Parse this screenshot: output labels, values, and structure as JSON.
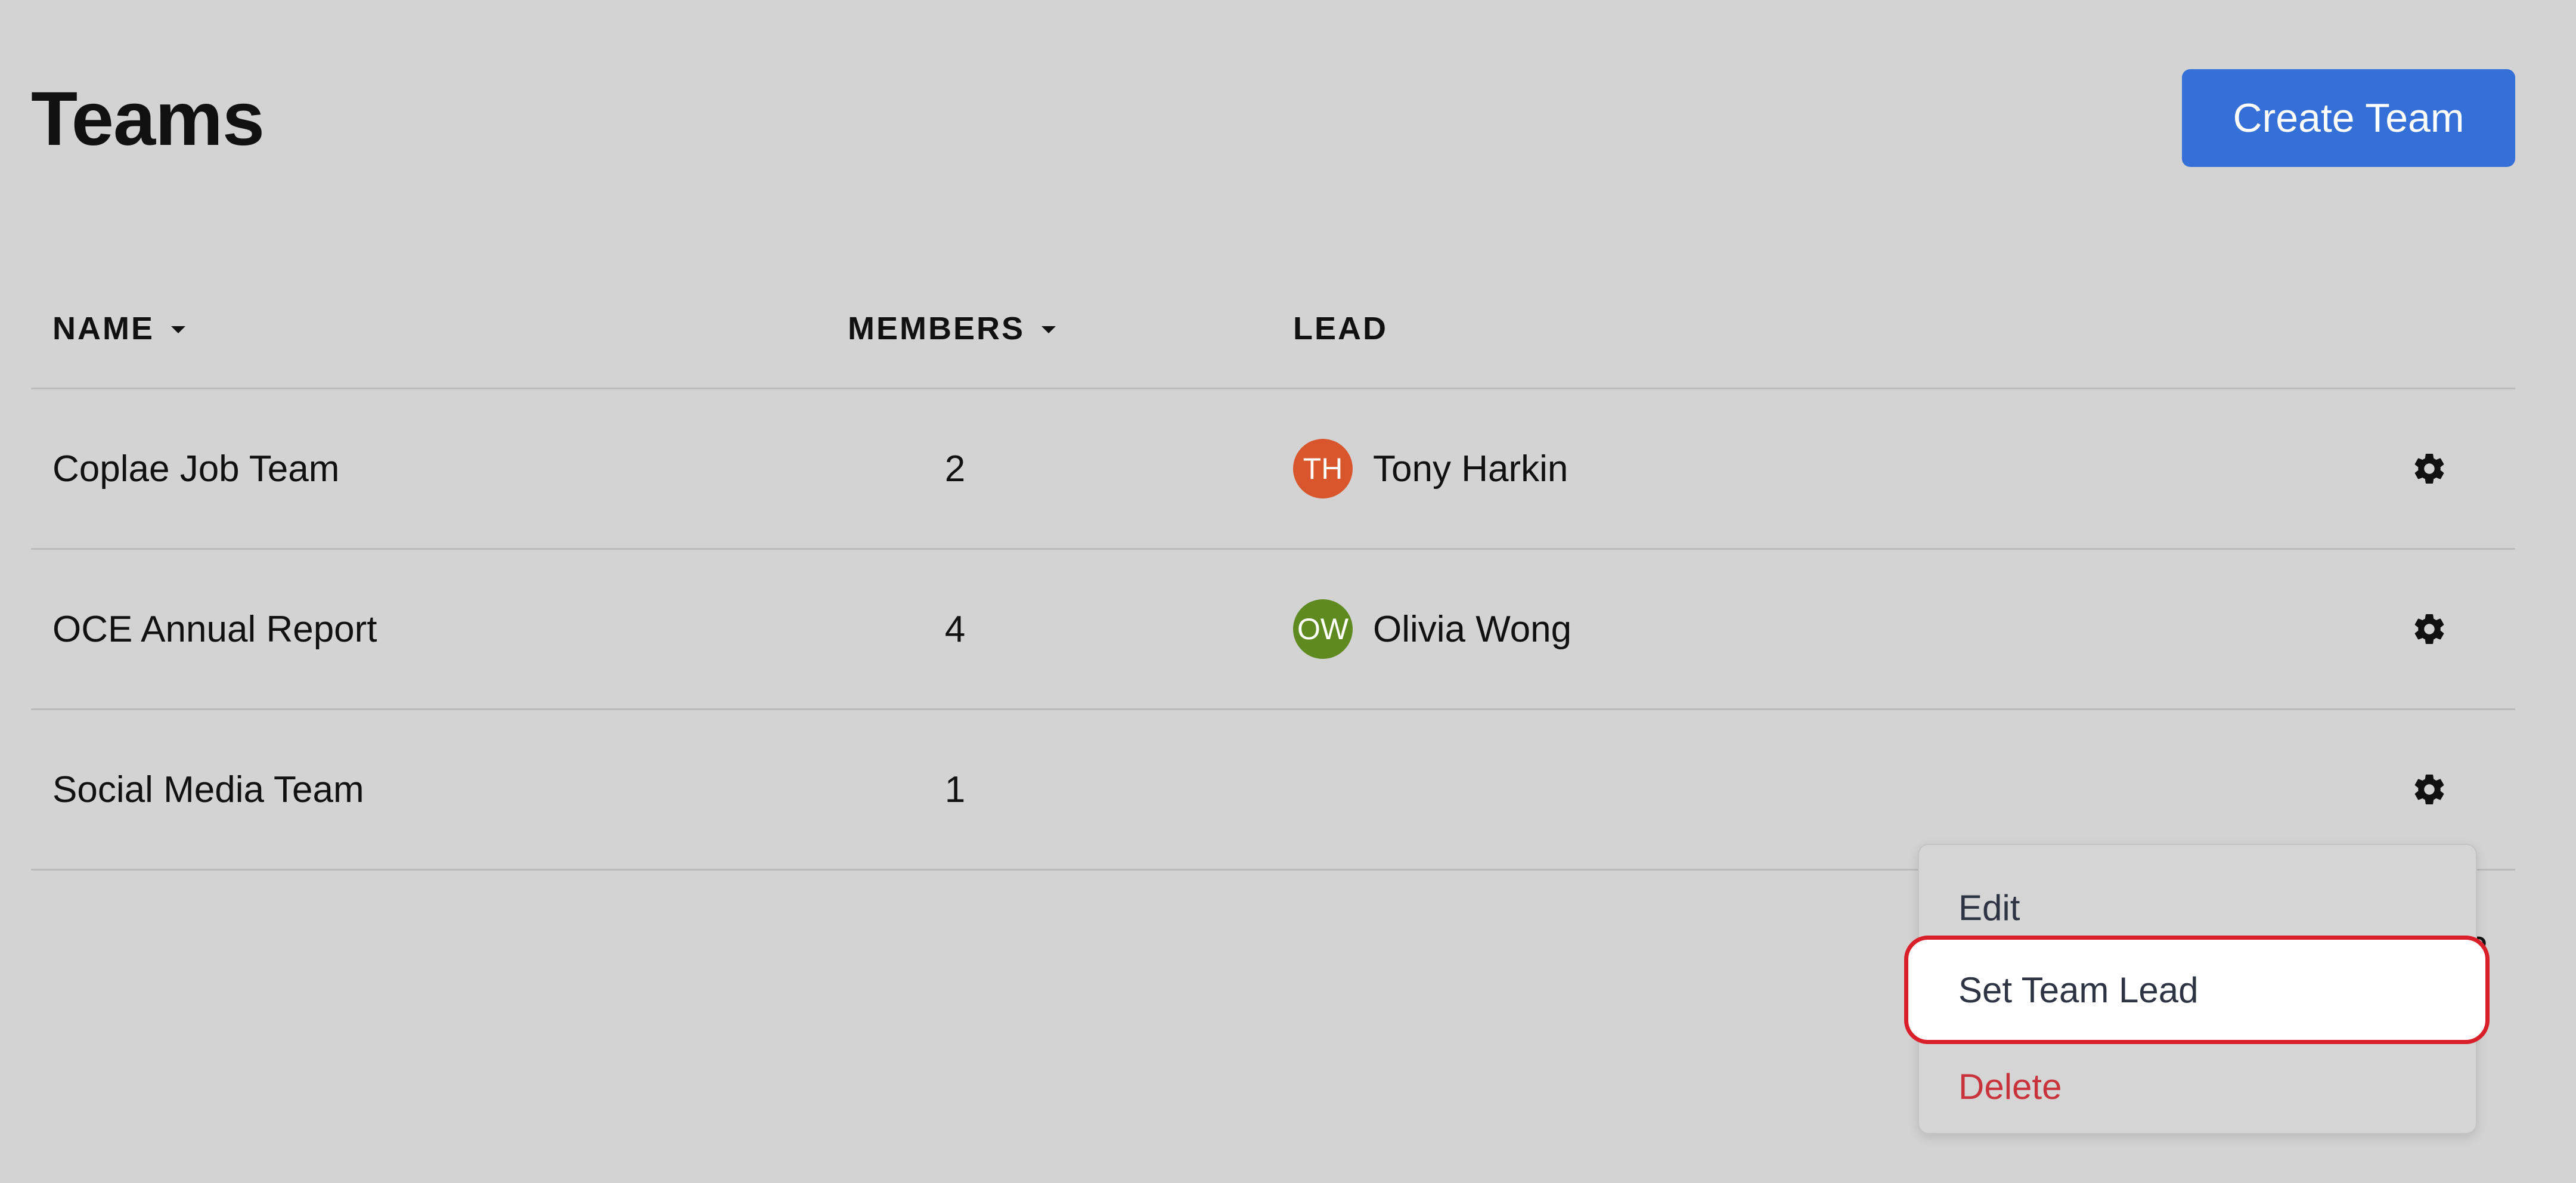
{
  "page": {
    "title": "Teams",
    "create_button_label": "Create Team",
    "pagination_text": "3"
  },
  "table": {
    "columns": {
      "name": "NAME",
      "members": "MEMBERS",
      "lead": "LEAD"
    },
    "rows": [
      {
        "name": "Coplae Job Team",
        "members": "2",
        "lead": {
          "initials": "TH",
          "name": "Tony Harkin",
          "color": "#d9562c"
        }
      },
      {
        "name": "OCE Annual Report",
        "members": "4",
        "lead": {
          "initials": "OW",
          "name": "Olivia Wong",
          "color": "#5f8a20"
        }
      },
      {
        "name": "Social Media Team",
        "members": "1",
        "lead": null
      }
    ]
  },
  "context_menu": {
    "items": [
      {
        "label": "Edit"
      },
      {
        "label": "Set Team Lead",
        "highlighted": true
      },
      {
        "label": "Delete",
        "destructive": true
      }
    ]
  },
  "colors": {
    "background": "#d3d3d3",
    "primary_button": "#3570d8",
    "destructive": "#c9343c",
    "highlight_border": "#d91f2a"
  },
  "icons": {
    "row_action": "gear-icon",
    "sort": "caret-down-icon"
  }
}
